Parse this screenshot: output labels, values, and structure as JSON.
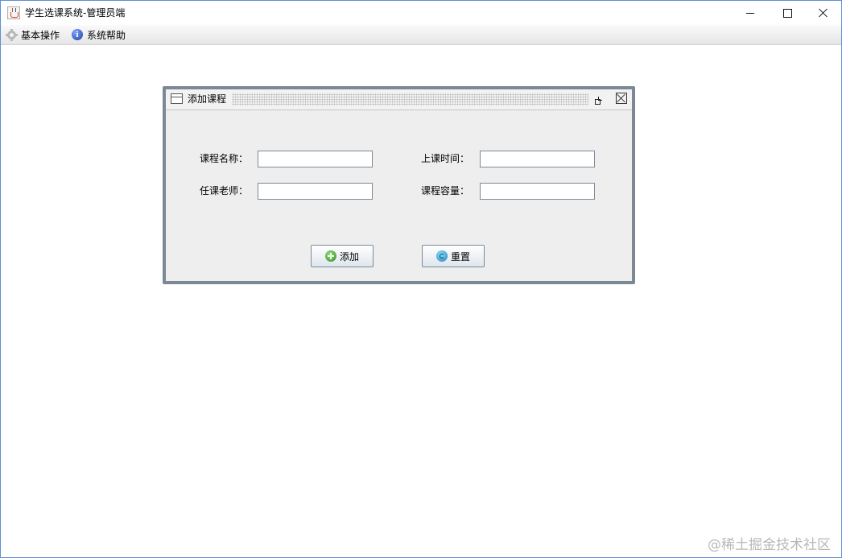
{
  "window": {
    "title": "学生选课系统-管理员端",
    "icon": "java-cup-icon"
  },
  "menubar": {
    "items": [
      {
        "label": "基本操作",
        "icon": "gear-icon"
      },
      {
        "label": "系统帮助",
        "icon": "info-icon"
      }
    ]
  },
  "internal_frame": {
    "title": "添加课程",
    "fields": {
      "course_name": {
        "label": "课程名称：",
        "value": ""
      },
      "class_time": {
        "label": "上课时间：",
        "value": ""
      },
      "teacher": {
        "label": "任课老师：",
        "value": ""
      },
      "capacity": {
        "label": "课程容量：",
        "value": ""
      }
    },
    "buttons": {
      "add": {
        "label": "添加",
        "icon": "add-icon"
      },
      "reset": {
        "label": "重置",
        "icon": "reset-icon"
      }
    }
  },
  "watermark": "@稀土掘金技术社区"
}
